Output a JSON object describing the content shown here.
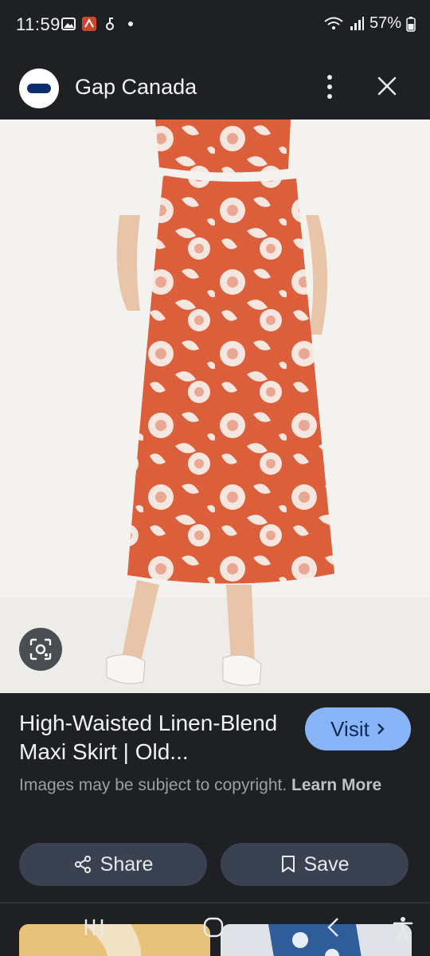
{
  "status": {
    "time": "11:59",
    "battery": "57%"
  },
  "header": {
    "site_name": "Gap Canada",
    "logo_text": "OLD NAVY"
  },
  "product": {
    "title": "High-Waisted Linen-Blend Maxi Skirt | Old...",
    "visit_label": "Visit",
    "copyright_text": "Images may be subject to copyright.",
    "learn_more": "Learn More",
    "share_label": "Share",
    "save_label": "Save"
  },
  "colors": {
    "background": "#1f2023",
    "visit_button": "#8ab4f8",
    "action_button": "#3a4150",
    "skirt": "#e0603f"
  }
}
